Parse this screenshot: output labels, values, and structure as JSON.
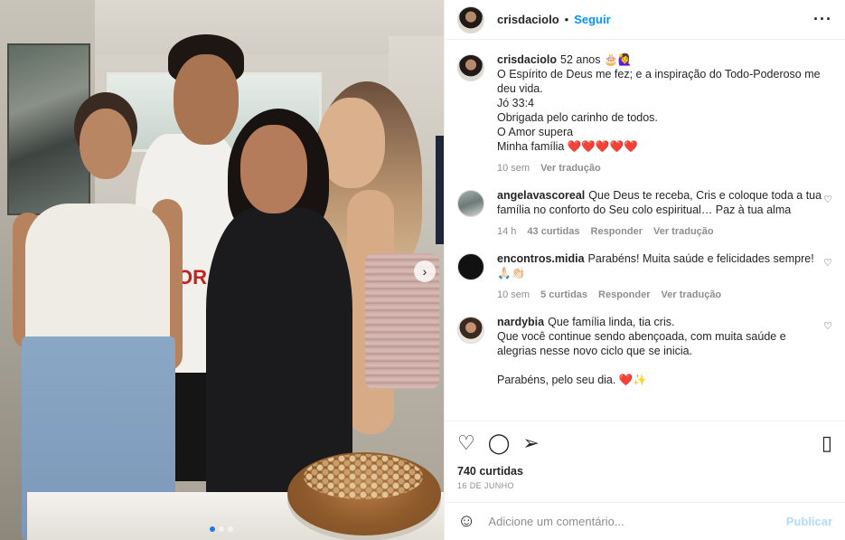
{
  "header": {
    "username": "crisdaciolo",
    "separator": "•",
    "follow_label": "Seguir",
    "more_icon": "more-horizontal-icon"
  },
  "photo": {
    "shirt_print": "OR IT",
    "carousel_next_icon": "chevron-right-icon",
    "dots": 3,
    "active_dot": 0
  },
  "caption": {
    "username": "crisdaciolo",
    "text": "52 anos 🎂🙋‍♀️\nO Espírito de Deus me fez; e a inspiração do Todo-Poderoso me deu vida.\nJó 33:4\nObrigada pelo carinho de todos.\nO Amor supera\nMinha família ❤️❤️❤️❤️❤️",
    "time": "10 sem",
    "translate": "Ver tradução"
  },
  "comments": [
    {
      "username": "angelavascoreal",
      "text": "Que Deus te receba, Cris e coloque toda a tua família no conforto do Seu colo espiritual… Paz à tua alma",
      "time": "14 h",
      "likes": "43 curtidas",
      "reply": "Responder",
      "translate": "Ver tradução"
    },
    {
      "username": "encontros.midia",
      "text": "Parabéns! Muita saúde e felicidades sempre! 🙏🏻👏🏻",
      "time": "10 sem",
      "likes": "5 curtidas",
      "reply": "Responder",
      "translate": "Ver tradução"
    },
    {
      "username": "nardybia",
      "text": "Que família linda, tia cris.\nQue você continue sendo abençoada, com muita saúde e alegrias nesse novo ciclo que se inicia.\n\nParabéns, pelo seu dia. ❤️✨",
      "time": "",
      "likes": "",
      "reply": "",
      "translate": ""
    }
  ],
  "actions": {
    "like_icon": "heart-icon",
    "comment_icon": "comment-icon",
    "share_icon": "share-icon",
    "save_icon": "bookmark-icon",
    "likes": "740 curtidas",
    "date": "16 DE JUNHO"
  },
  "add_comment": {
    "emoji_icon": "emoji-icon",
    "placeholder": "Adicione um comentário...",
    "publish_label": "Publicar"
  },
  "colors": {
    "accent": "#0095f6",
    "muted": "#8e8e8e",
    "publish_disabled": "#b3dbff"
  }
}
